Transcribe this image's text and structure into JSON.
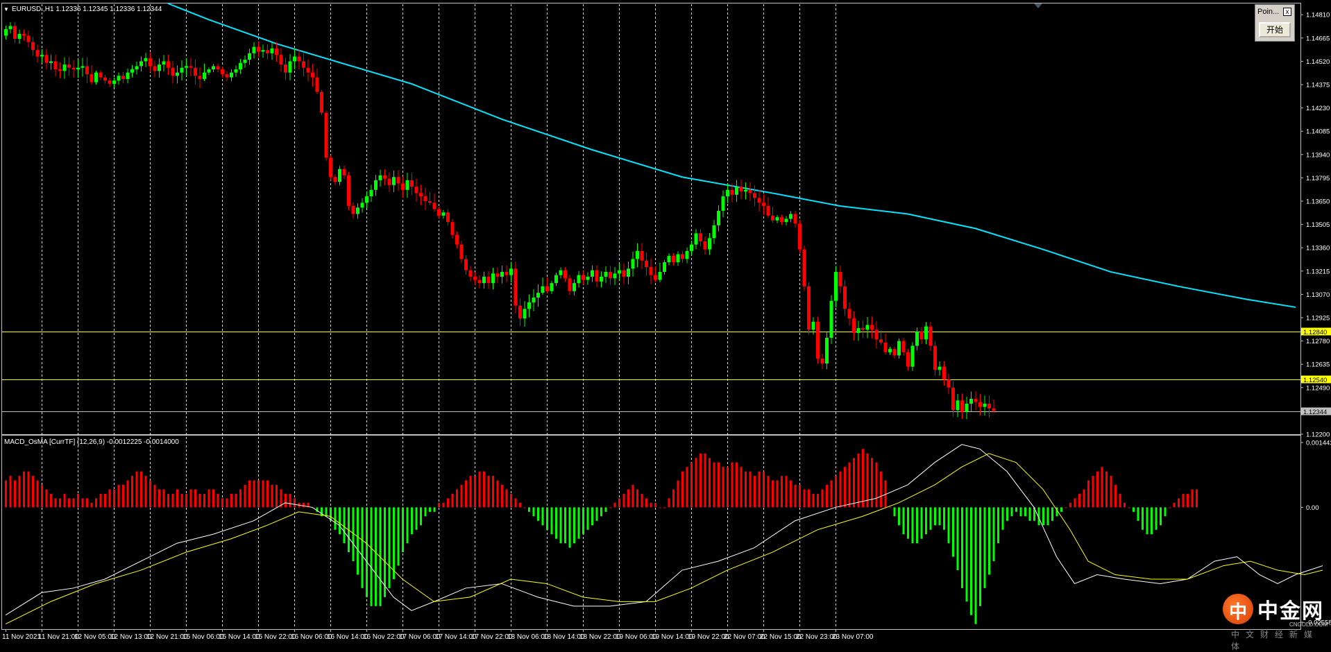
{
  "window": {
    "chart_header": "EURUSD.,H1  1.12336 1.12345 1.12336 1.12344",
    "indicator_header": "MACD_OsMA [CurrTF] (12,26,9) -0.0012225 -0.0014000",
    "menu_glyph": "▼"
  },
  "point_panel": {
    "title": "Poin...",
    "close_label": "x",
    "start_button": "开始"
  },
  "watermark": {
    "logo_char": "中",
    "name": "中金网",
    "domain": "CNGOLD.COM",
    "slogan": "中文财经新媒体"
  },
  "colors": {
    "bull": "#00ff00",
    "bear": "#ff0000",
    "ma": "#00e5ff",
    "level": "#ffff00",
    "bid": "#c0c0c0",
    "hist_pos": "#ff0000",
    "hist_neg": "#00ff00",
    "macd": "#ffffff",
    "signal": "#ffff00",
    "grid": "#ffffff",
    "background": "#000000"
  },
  "price_axis": {
    "labels": [
      "1.14810",
      "1.14665",
      "1.14520",
      "1.14375",
      "1.14230",
      "1.14085",
      "1.13940",
      "1.13795",
      "1.13650",
      "1.13505",
      "1.13360",
      "1.13215",
      "1.13070",
      "1.12925",
      "1.12780",
      "1.12635",
      "1.12490",
      "1.12200"
    ],
    "values": [
      1.1481,
      1.14665,
      1.1452,
      1.14375,
      1.1423,
      1.14085,
      1.1394,
      1.13795,
      1.1365,
      1.13505,
      1.1336,
      1.13215,
      1.1307,
      1.12925,
      1.1278,
      1.12635,
      1.1249,
      1.122
    ]
  },
  "levels": [
    {
      "label": "1.12840",
      "value": 1.1284,
      "color": "#ffff00"
    },
    {
      "label": "1.12540",
      "value": 1.1254,
      "color": "#ffff00"
    },
    {
      "label": "1.12344",
      "value": 1.12344,
      "color": "#c0c0c0"
    }
  ],
  "indicator_axis": {
    "labels": [
      "0.0014434",
      "0.00",
      "-0.025581"
    ],
    "values": [
      0.0014434,
      0,
      -0.002558
    ]
  },
  "time_axis": {
    "labels": [
      "11 Nov 2021",
      "11 Nov 21:00",
      "12 Nov 05:00",
      "12 Nov 13:00",
      "12 Nov 21:00",
      "15 Nov 06:00",
      "15 Nov 14:00",
      "15 Nov 22:00",
      "16 Nov 06:00",
      "16 Nov 14:00",
      "16 Nov 22:00",
      "17 Nov 06:00",
      "17 Nov 14:00",
      "17 Nov 22:00",
      "18 Nov 06:00",
      "18 Nov 14:00",
      "18 Nov 22:00",
      "19 Nov 06:00",
      "19 Nov 14:00",
      "19 Nov 22:00",
      "22 Nov 07:00",
      "22 Nov 15:00",
      "22 Nov 23:00",
      "23 Nov 07:00"
    ]
  },
  "chart_data": {
    "type": "candlestick",
    "symbol": "EURUSD.",
    "timeframe": "H1",
    "ylim": [
      1.122,
      1.1488
    ],
    "period_bars": 8,
    "grid": "vertical-dashed",
    "closes": [
      1.1472,
      1.1474,
      1.1466,
      1.1469,
      1.1468,
      1.1464,
      1.1459,
      1.1455,
      1.1456,
      1.1451,
      1.1452,
      1.1447,
      1.1446,
      1.145,
      1.1448,
      1.1447,
      1.1448,
      1.1449,
      1.1444,
      1.1439,
      1.1445,
      1.1442,
      1.144,
      1.1438,
      1.144,
      1.1443,
      1.1441,
      1.1445,
      1.1447,
      1.1449,
      1.1452,
      1.1454,
      1.1449,
      1.1446,
      1.145,
      1.1452,
      1.1448,
      1.1443,
      1.1445,
      1.1448,
      1.1449,
      1.1448,
      1.1443,
      1.1441,
      1.1445,
      1.1447,
      1.1449,
      1.1447,
      1.1444,
      1.1442,
      1.1445,
      1.1447,
      1.1451,
      1.1453,
      1.1457,
      1.1461,
      1.1458,
      1.1459,
      1.1457,
      1.146,
      1.1456,
      1.145,
      1.1445,
      1.1452,
      1.1455,
      1.1452,
      1.1448,
      1.1445,
      1.1442,
      1.1433,
      1.142,
      1.1392,
      1.138,
      1.1377,
      1.1385,
      1.1381,
      1.1362,
      1.1357,
      1.1361,
      1.1364,
      1.1368,
      1.1372,
      1.1378,
      1.1381,
      1.1379,
      1.1375,
      1.138,
      1.1376,
      1.1372,
      1.1378,
      1.1374,
      1.137,
      1.1368,
      1.1365,
      1.1364,
      1.136,
      1.1356,
      1.1358,
      1.1352,
      1.1344,
      1.1338,
      1.1329,
      1.1322,
      1.1318,
      1.1316,
      1.1314,
      1.1318,
      1.1314,
      1.132,
      1.1318,
      1.1321,
      1.1319,
      1.1323,
      1.13,
      1.1292,
      1.1298,
      1.1302,
      1.1305,
      1.1308,
      1.1312,
      1.1309,
      1.1314,
      1.1319,
      1.1322,
      1.1317,
      1.1309,
      1.1314,
      1.1319,
      1.1316,
      1.1318,
      1.1322,
      1.1315,
      1.1318,
      1.1321,
      1.1317,
      1.132,
      1.1322,
      1.1318,
      1.1323,
      1.1329,
      1.1334,
      1.1328,
      1.1324,
      1.1319,
      1.1316,
      1.1321,
      1.1327,
      1.1331,
      1.1327,
      1.1332,
      1.1329,
      1.1334,
      1.1338,
      1.1345,
      1.134,
      1.1335,
      1.1342,
      1.135,
      1.1359,
      1.1368,
      1.1372,
      1.1369,
      1.1374,
      1.1371,
      1.1372,
      1.137,
      1.1367,
      1.1364,
      1.1362,
      1.1356,
      1.1353,
      1.1355,
      1.1352,
      1.1354,
      1.1357,
      1.1351,
      1.1335,
      1.1312,
      1.1285,
      1.129,
      1.1267,
      1.1264,
      1.128,
      1.1303,
      1.1321,
      1.1312,
      1.1298,
      1.1292,
      1.1283,
      1.1286,
      1.1285,
      1.1288,
      1.1285,
      1.1279,
      1.1277,
      1.1271,
      1.1273,
      1.1269,
      1.1278,
      1.1271,
      1.1262,
      1.1275,
      1.1284,
      1.1279,
      1.1287,
      1.1275,
      1.126,
      1.1262,
      1.1254,
      1.1249,
      1.1235,
      1.1241,
      1.1234,
      1.1239,
      1.1242,
      1.124,
      1.1237,
      1.1239,
      1.1236,
      1.12344
    ],
    "ma_series": [
      {
        "bar": 36,
        "value": 1.1488
      },
      {
        "bar": 45,
        "value": 1.1478
      },
      {
        "bar": 60,
        "value": 1.1463
      },
      {
        "bar": 90,
        "value": 1.1438
      },
      {
        "bar": 110,
        "value": 1.1416
      },
      {
        "bar": 130,
        "value": 1.1397
      },
      {
        "bar": 150,
        "value": 1.138
      },
      {
        "bar": 170,
        "value": 1.137
      },
      {
        "bar": 185,
        "value": 1.1362
      },
      {
        "bar": 200,
        "value": 1.1357
      },
      {
        "bar": 215,
        "value": 1.1348
      },
      {
        "bar": 230,
        "value": 1.1335
      },
      {
        "bar": 245,
        "value": 1.1321
      },
      {
        "bar": 260,
        "value": 1.1312
      },
      {
        "bar": 275,
        "value": 1.1304
      },
      {
        "bar": 286,
        "value": 1.1299
      }
    ],
    "macd_histogram": [
      0.0006,
      0.0007,
      0.0006,
      0.0007,
      0.0008,
      0.0008,
      0.0007,
      0.0006,
      0.0005,
      0.0004,
      0.0003,
      0.0002,
      0.0002,
      0.0003,
      0.0002,
      0.0002,
      0.0003,
      0.0002,
      0.0002,
      0.0001,
      0.0002,
      0.0003,
      0.0003,
      0.0004,
      0.0004,
      0.0005,
      0.0005,
      0.0006,
      0.0007,
      0.0008,
      0.0008,
      0.0007,
      0.0006,
      0.0005,
      0.0004,
      0.0004,
      0.0003,
      0.0003,
      0.0004,
      0.0003,
      0.0003,
      0.0004,
      0.0004,
      0.0003,
      0.0003,
      0.0004,
      0.0004,
      0.0003,
      0.0002,
      0.0002,
      0.0003,
      0.0003,
      0.0004,
      0.0005,
      0.0006,
      0.0006,
      0.0006,
      0.0006,
      0.0006,
      0.0005,
      0.0005,
      0.0004,
      0.0003,
      0.0003,
      0.0002,
      0.0001,
      0.0001,
      0.0001,
      0.0,
      -0.0001,
      -0.0002,
      -0.0002,
      -0.0003,
      -0.0005,
      -0.0006,
      -0.0008,
      -0.001,
      -0.0012,
      -0.0015,
      -0.0018,
      -0.002,
      -0.0022,
      -0.0022,
      -0.0022,
      -0.002,
      -0.0018,
      -0.0016,
      -0.0013,
      -0.001,
      -0.0008,
      -0.0006,
      -0.0005,
      -0.0004,
      -0.0002,
      -0.0001,
      -0.0001,
      0.0001,
      0.0001,
      0.0002,
      0.0003,
      0.0004,
      0.0005,
      0.0006,
      0.0007,
      0.0007,
      0.0008,
      0.0008,
      0.0007,
      0.0007,
      0.0006,
      0.0005,
      0.0004,
      0.0003,
      0.0002,
      0.0001,
      0.0,
      -0.0001,
      -0.0002,
      -0.0003,
      -0.0004,
      -0.0005,
      -0.0006,
      -0.0007,
      -0.0008,
      -0.0008,
      -0.0009,
      -0.0008,
      -0.0007,
      -0.0006,
      -0.0005,
      -0.0004,
      -0.0003,
      -0.0002,
      -0.0001,
      0.0,
      0.0001,
      0.0002,
      0.0003,
      0.0004,
      0.0005,
      0.0004,
      0.0003,
      0.0002,
      0.0001,
      0.0001,
      0.0,
      0.0,
      0.0002,
      0.0004,
      0.0006,
      0.0008,
      0.0009,
      0.001,
      0.0011,
      0.0012,
      0.0012,
      0.0011,
      0.001,
      0.001,
      0.0009,
      0.0009,
      0.001,
      0.001,
      0.0009,
      0.0008,
      0.0008,
      0.0007,
      0.0008,
      0.0008,
      0.0007,
      0.0006,
      0.0006,
      0.0007,
      0.0007,
      0.0006,
      0.0005,
      0.0005,
      0.0004,
      0.0004,
      0.0003,
      0.0003,
      0.0004,
      0.0005,
      0.0006,
      0.0007,
      0.0008,
      0.0009,
      0.001,
      0.0011,
      0.0012,
      0.0013,
      0.0012,
      0.0011,
      0.001,
      0.0008,
      0.0006,
      0.0,
      -0.0002,
      -0.0004,
      -0.0006,
      -0.0007,
      -0.0008,
      -0.0008,
      -0.0007,
      -0.0006,
      -0.0005,
      -0.0004,
      -0.0004,
      -0.0005,
      -0.0008,
      -0.0011,
      -0.0014,
      -0.0018,
      -0.0021,
      -0.0024,
      -0.0026,
      -0.0022,
      -0.0018,
      -0.0015,
      -0.0012,
      -0.0008,
      -0.0005,
      -0.0003,
      -0.0002,
      -0.0001,
      -0.0002,
      -0.0002,
      -0.0003,
      -0.0003,
      -0.0004,
      -0.0004,
      -0.0004,
      -0.0003,
      -0.0002,
      -0.0001,
      0.0,
      0.0001,
      0.0002,
      0.0003,
      0.0004,
      0.0006,
      0.0007,
      0.0008,
      0.0009,
      0.0008,
      0.0007,
      0.0005,
      0.0003,
      0.0001,
      0.0,
      -0.0001,
      -0.0003,
      -0.0005,
      -0.0006,
      -0.0006,
      -0.0005,
      -0.0004,
      -0.0002,
      0.0,
      0.0001,
      0.0002,
      0.0003,
      0.0003,
      0.0004,
      0.0004
    ],
    "macd_line": [
      {
        "bar": 0,
        "value": -0.0024
      },
      {
        "bar": 8,
        "value": -0.0019
      },
      {
        "bar": 15,
        "value": -0.0018
      },
      {
        "bar": 22,
        "value": -0.0016
      },
      {
        "bar": 30,
        "value": -0.0012
      },
      {
        "bar": 38,
        "value": -0.0008
      },
      {
        "bar": 46,
        "value": -0.0006
      },
      {
        "bar": 55,
        "value": -0.0003
      },
      {
        "bar": 62,
        "value": 0.0001
      },
      {
        "bar": 68,
        "value": 0.0
      },
      {
        "bar": 74,
        "value": -0.0004
      },
      {
        "bar": 80,
        "value": -0.0012
      },
      {
        "bar": 86,
        "value": -0.002
      },
      {
        "bar": 90,
        "value": -0.0023
      },
      {
        "bar": 95,
        "value": -0.0021
      },
      {
        "bar": 102,
        "value": -0.0018
      },
      {
        "bar": 110,
        "value": -0.0017
      },
      {
        "bar": 118,
        "value": -0.002
      },
      {
        "bar": 126,
        "value": -0.0022
      },
      {
        "bar": 134,
        "value": -0.0022
      },
      {
        "bar": 142,
        "value": -0.0021
      },
      {
        "bar": 150,
        "value": -0.0014
      },
      {
        "bar": 158,
        "value": -0.0012
      },
      {
        "bar": 166,
        "value": -0.0009
      },
      {
        "bar": 175,
        "value": -0.0003
      },
      {
        "bar": 184,
        "value": 0.0
      },
      {
        "bar": 193,
        "value": 0.0002
      },
      {
        "bar": 200,
        "value": 0.0005
      },
      {
        "bar": 206,
        "value": 0.001
      },
      {
        "bar": 212,
        "value": 0.0014
      },
      {
        "bar": 216,
        "value": 0.0013
      },
      {
        "bar": 222,
        "value": 0.0008
      },
      {
        "bar": 228,
        "value": 0.0
      },
      {
        "bar": 233,
        "value": -0.0011
      },
      {
        "bar": 237,
        "value": -0.0017
      },
      {
        "bar": 242,
        "value": -0.0015
      },
      {
        "bar": 248,
        "value": -0.0016
      },
      {
        "bar": 256,
        "value": -0.0017
      },
      {
        "bar": 262,
        "value": -0.0016
      },
      {
        "bar": 268,
        "value": -0.0012
      },
      {
        "bar": 273,
        "value": -0.0011
      },
      {
        "bar": 278,
        "value": -0.0015
      },
      {
        "bar": 282,
        "value": -0.0017
      },
      {
        "bar": 286,
        "value": -0.0015
      },
      {
        "bar": 292,
        "value": -0.0013
      }
    ],
    "signal_line": [
      {
        "bar": 0,
        "value": -0.0026
      },
      {
        "bar": 10,
        "value": -0.0021
      },
      {
        "bar": 20,
        "value": -0.0017
      },
      {
        "bar": 30,
        "value": -0.0014
      },
      {
        "bar": 40,
        "value": -0.001
      },
      {
        "bar": 50,
        "value": -0.0007
      },
      {
        "bar": 58,
        "value": -0.0004
      },
      {
        "bar": 65,
        "value": -0.0001
      },
      {
        "bar": 72,
        "value": -0.0002
      },
      {
        "bar": 80,
        "value": -0.0008
      },
      {
        "bar": 88,
        "value": -0.0016
      },
      {
        "bar": 95,
        "value": -0.0021
      },
      {
        "bar": 103,
        "value": -0.002
      },
      {
        "bar": 112,
        "value": -0.0016
      },
      {
        "bar": 120,
        "value": -0.0017
      },
      {
        "bar": 128,
        "value": -0.002
      },
      {
        "bar": 136,
        "value": -0.0021
      },
      {
        "bar": 144,
        "value": -0.0021
      },
      {
        "bar": 152,
        "value": -0.0018
      },
      {
        "bar": 160,
        "value": -0.0014
      },
      {
        "bar": 170,
        "value": -0.001
      },
      {
        "bar": 180,
        "value": -0.0005
      },
      {
        "bar": 190,
        "value": -0.0002
      },
      {
        "bar": 198,
        "value": 0.0001
      },
      {
        "bar": 206,
        "value": 0.0005
      },
      {
        "bar": 212,
        "value": 0.0009
      },
      {
        "bar": 218,
        "value": 0.0012
      },
      {
        "bar": 224,
        "value": 0.001
      },
      {
        "bar": 230,
        "value": 0.0004
      },
      {
        "bar": 236,
        "value": -0.0005
      },
      {
        "bar": 240,
        "value": -0.0012
      },
      {
        "bar": 246,
        "value": -0.0015
      },
      {
        "bar": 254,
        "value": -0.0016
      },
      {
        "bar": 262,
        "value": -0.0016
      },
      {
        "bar": 270,
        "value": -0.0013
      },
      {
        "bar": 276,
        "value": -0.0012
      },
      {
        "bar": 282,
        "value": -0.0014
      },
      {
        "bar": 288,
        "value": -0.0015
      },
      {
        "bar": 292,
        "value": -0.0014
      }
    ]
  }
}
